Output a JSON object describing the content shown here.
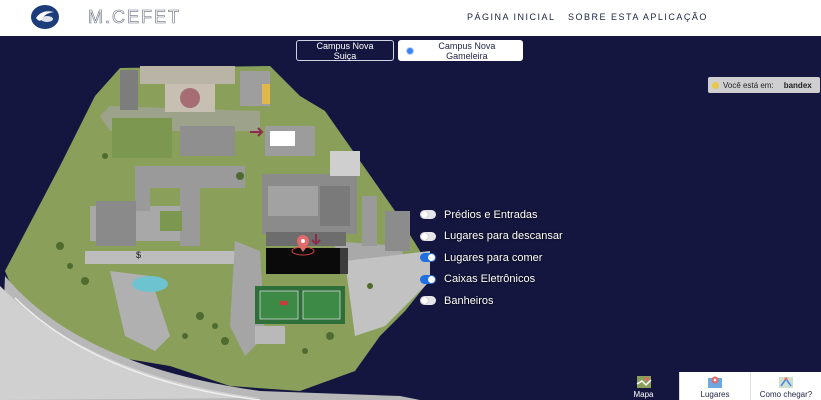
{
  "brand": {
    "name": "M.CEFET"
  },
  "nav": {
    "home": "PÁGINA INICIAL",
    "about": "SOBRE ESTA APLICAÇÃO"
  },
  "campus": {
    "option1": "Campus Nova Suiça",
    "option2": "Campus Nova Gameleira",
    "selected": "Campus Nova Gameleira"
  },
  "location": {
    "label": "Você está em:",
    "value": "bandex"
  },
  "filters": [
    {
      "label": "Prédios e Entradas",
      "on": false
    },
    {
      "label": "Lugares para descansar",
      "on": false
    },
    {
      "label": "Lugares para comer",
      "on": true
    },
    {
      "label": "Caixas Eletrônicos",
      "on": true
    },
    {
      "label": "Banheiros",
      "on": false
    }
  ],
  "tabs": {
    "map": "Mapa",
    "places": "Lugares",
    "directions": "Como chegar?",
    "active": "Mapa"
  },
  "colors": {
    "background": "#14163f",
    "accent": "#1f6fe0",
    "grass": "#8aa05a",
    "pin": "#e26a6a"
  }
}
